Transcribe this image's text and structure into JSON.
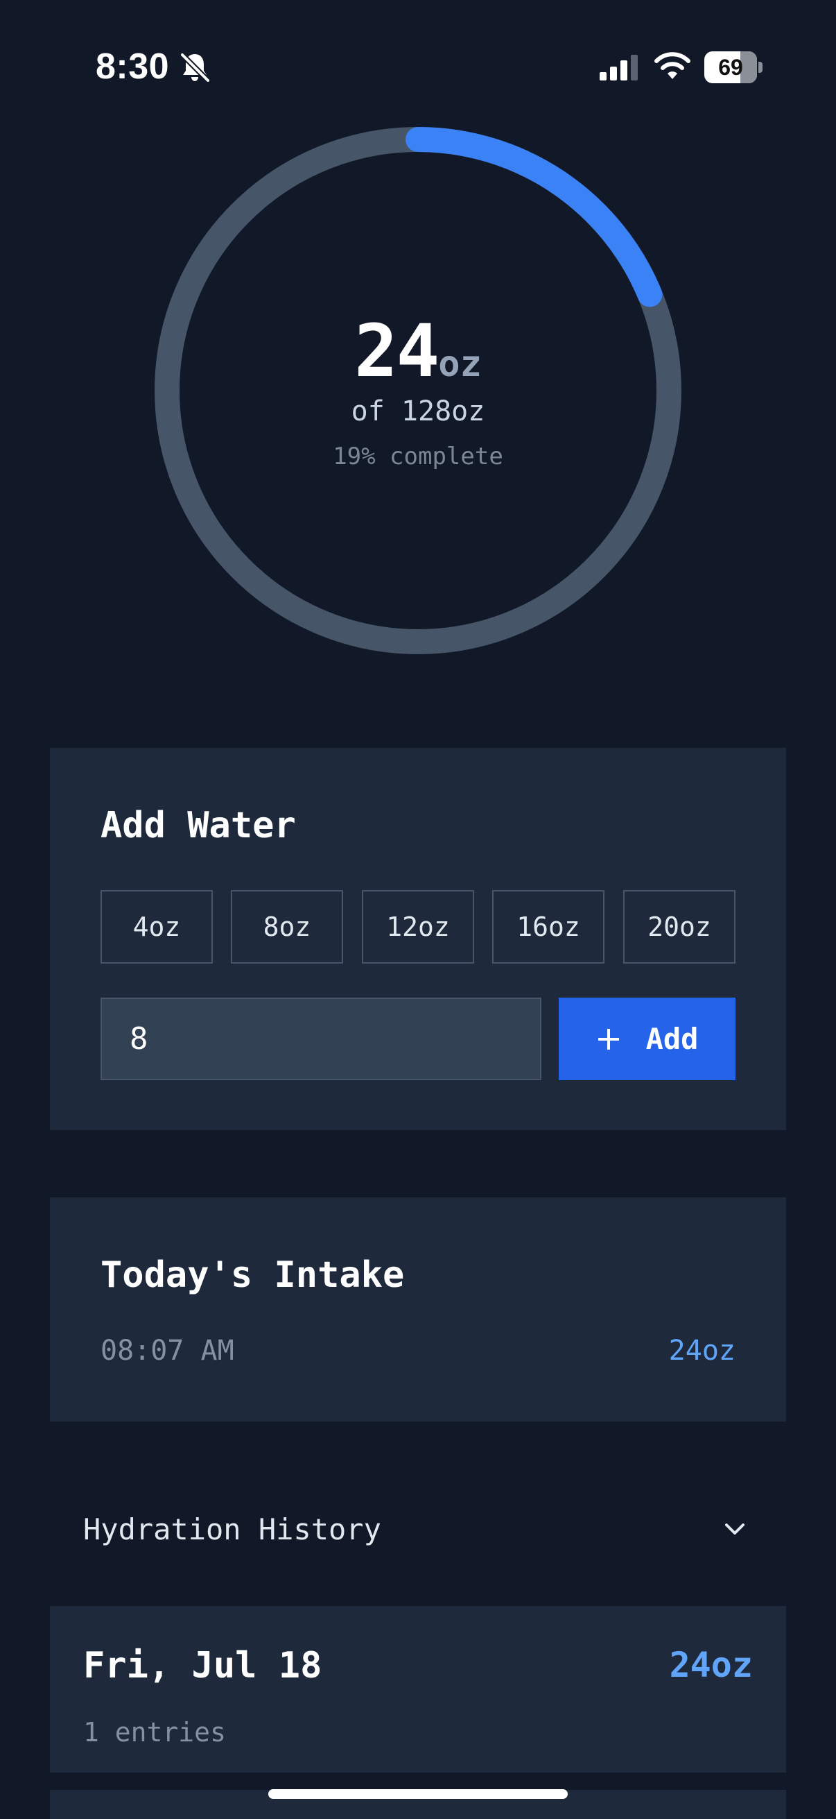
{
  "status_bar": {
    "time": "8:30",
    "battery_level": "69",
    "icons": [
      "bell-slash-icon",
      "cellular-signal-icon",
      "wifi-icon",
      "battery-icon"
    ]
  },
  "progress": {
    "current_value": "24",
    "unit": "oz",
    "goal_text": "of 128oz",
    "percent_text": "19% complete",
    "fraction": 0.1875,
    "track_color": "#475569",
    "fill_color": "#3b82f6"
  },
  "add_water": {
    "title": "Add Water",
    "presets": [
      {
        "label": "4oz"
      },
      {
        "label": "8oz"
      },
      {
        "label": "12oz"
      },
      {
        "label": "16oz"
      },
      {
        "label": "20oz"
      }
    ],
    "input_value": "8",
    "add_label": "Add",
    "accent_color": "#2563eb"
  },
  "intake": {
    "title": "Today's Intake",
    "entries": [
      {
        "time": "08:07 AM",
        "amount": "24oz"
      }
    ]
  },
  "history": {
    "title": "Hydration History",
    "items": [
      {
        "date": "Fri, Jul 18",
        "total": "24oz",
        "entries": "1 entries"
      }
    ]
  },
  "colors": {
    "background": "#111827",
    "card": "#1e293b",
    "accent_text": "#60a5fa"
  }
}
